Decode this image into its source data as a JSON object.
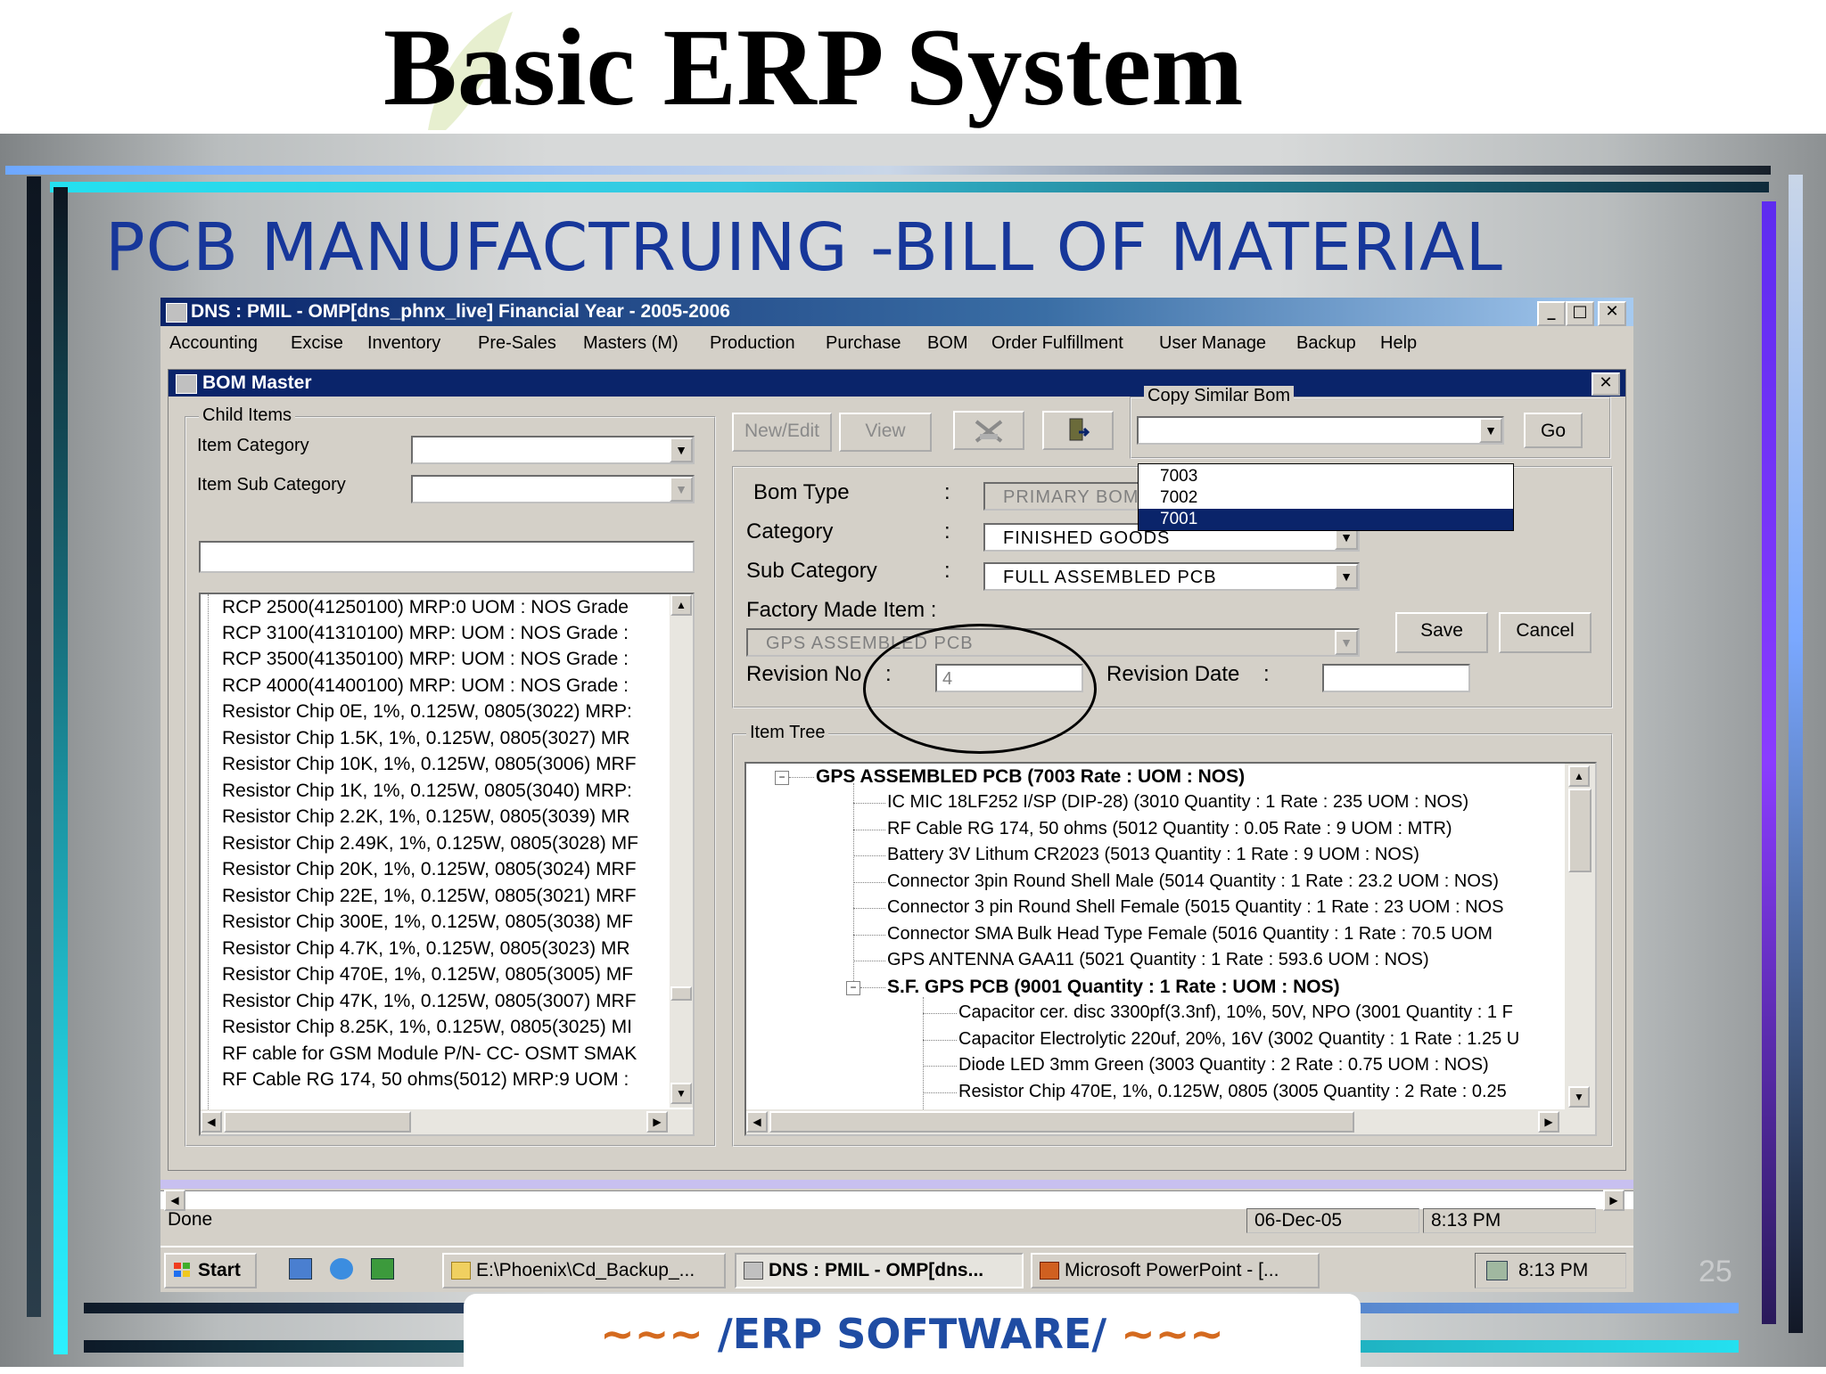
{
  "slide": {
    "title": "Basic ERP System",
    "heading": "PCB MANUFACTRUING -BILL OF MATERIAL",
    "footer": {
      "left": "~~~",
      "text": " /ERP SOFTWARE/ ",
      "right": "~~~"
    },
    "page_number": "25"
  },
  "app": {
    "title": "DNS : PMIL - OMP[dns_phnx_live] Financial Year - 2005-2006",
    "window_buttons": [
      "_",
      "□",
      "✕"
    ],
    "menu": [
      "Accounting",
      "Excise",
      "Inventory",
      "Pre-Sales",
      "Masters (M)",
      "Production",
      "Purchase",
      "BOM",
      "Order Fulfillment",
      "User Manage",
      "Backup",
      "Help"
    ]
  },
  "bom": {
    "title": "BOM Master",
    "close": "✕",
    "child_items": {
      "label": "Child Items",
      "item_category_label": "Item Category",
      "item_sub_category_label": "Item Sub Category",
      "items": [
        "RCP 2500(41250100) MRP:0 UOM : NOS Grade",
        "RCP 3100(41310100) MRP: UOM : NOS Grade :",
        "RCP 3500(41350100) MRP: UOM : NOS Grade :",
        "RCP 4000(41400100) MRP: UOM : NOS Grade :",
        "Resistor Chip 0E, 1%, 0.125W, 0805(3022) MRP:",
        "Resistor Chip 1.5K, 1%, 0.125W, 0805(3027) MR",
        "Resistor Chip 10K, 1%, 0.125W, 0805(3006) MRF",
        "Resistor Chip 1K, 1%, 0.125W, 0805(3040) MRP:",
        "Resistor Chip 2.2K, 1%, 0.125W, 0805(3039) MR",
        "Resistor Chip 2.49K, 1%, 0.125W, 0805(3028) MF",
        "Resistor Chip 20K, 1%, 0.125W, 0805(3024) MRF",
        "Resistor Chip 22E, 1%, 0.125W, 0805(3021) MRF",
        "Resistor Chip 300E, 1%, 0.125W, 0805(3038) MF",
        "Resistor Chip 4.7K, 1%, 0.125W, 0805(3023) MR",
        "Resistor Chip 470E, 1%, 0.125W, 0805(3005) MF",
        "Resistor Chip 47K, 1%, 0.125W, 0805(3007) MRF",
        "Resistor Chip 8.25K, 1%, 0.125W, 0805(3025) MI",
        "RF cable for GSM Module P/N- CC- OSMT SMAK",
        "RF Cable RG 174, 50 ohms(5012) MRP:9 UOM :"
      ]
    },
    "toolbar": {
      "new_edit": "New/Edit",
      "view": "View",
      "delete_icon": "x-delete-icon",
      "exit_icon": "exit-door-icon"
    },
    "copy_similar": {
      "label": "Copy Similar Bom",
      "go": "Go",
      "options": [
        "7003",
        "7002",
        "7001"
      ],
      "selected": "7001"
    },
    "form": {
      "bom_type_label": "Bom Type",
      "bom_type": "PRIMARY BOM",
      "category_label": "Category",
      "category": "FINISHED GOODS",
      "sub_category_label": "Sub Category",
      "sub_category": "FULL ASSEMBLED PCB",
      "factory_made_label": "Factory Made Item :",
      "factory_made": "GPS ASSEMBLED PCB",
      "revision_no_label": "Revision No",
      "revision_no": "4",
      "revision_date_label": "Revision Date",
      "revision_date": "",
      "colon": ":",
      "save": "Save",
      "cancel": "Cancel"
    },
    "item_tree": {
      "label": "Item Tree",
      "root": "GPS ASSEMBLED PCB (7003 Rate :   UOM : NOS)",
      "children": [
        "IC MIC 18LF252 I/SP (DIP-28) (3010 Quantity : 1 Rate : 235 UOM : NOS)",
        "RF Cable RG 174, 50 ohms (5012 Quantity : 0.05 Rate : 9 UOM : MTR)",
        "Battery 3V Lithum CR2023 (5013 Quantity : 1 Rate : 9 UOM : NOS)",
        "Connector 3pin Round Shell Male (5014 Quantity : 1 Rate : 23.2 UOM : NOS)",
        "Connector 3 pin Round Shell Female (5015 Quantity : 1 Rate : 23 UOM : NOS",
        "Connector SMA Bulk Head Type Female (5016 Quantity : 1 Rate : 70.5 UOM",
        "GPS ANTENNA GAA11 (5021 Quantity : 1 Rate : 593.6 UOM : NOS)"
      ],
      "sub_node": "S.F. GPS PCB (9001 Quantity : 1 Rate :   UOM : NOS)",
      "sub_children": [
        "Capacitor cer. disc 3300pf(3.3nf), 10%, 50V, NPO (3001 Quantity : 1 F",
        "Capacitor Electrolytic 220uf, 20%, 16V (3002 Quantity : 1 Rate : 1.25 U",
        "Diode LED 3mm Green (3003 Quantity : 2 Rate : 0.75 UOM : NOS)",
        "Resistor Chip 470E, 1%, 0.125W, 0805 (3005 Quantity : 2 Rate : 0.25"
      ]
    }
  },
  "status": {
    "text": "Done",
    "date": "06-Dec-05",
    "time": "8:13 PM"
  },
  "taskbar": {
    "start": "Start",
    "tasks": [
      "E:\\Phoenix\\Cd_Backup_...",
      "DNS : PMIL - OMP[dns...",
      "Microsoft PowerPoint - [..."
    ],
    "clock": "8:13 PM"
  },
  "colors": {
    "heading": "#17379a",
    "titlebar": "#0a246a",
    "footer_tilde": "#d46a1f"
  }
}
